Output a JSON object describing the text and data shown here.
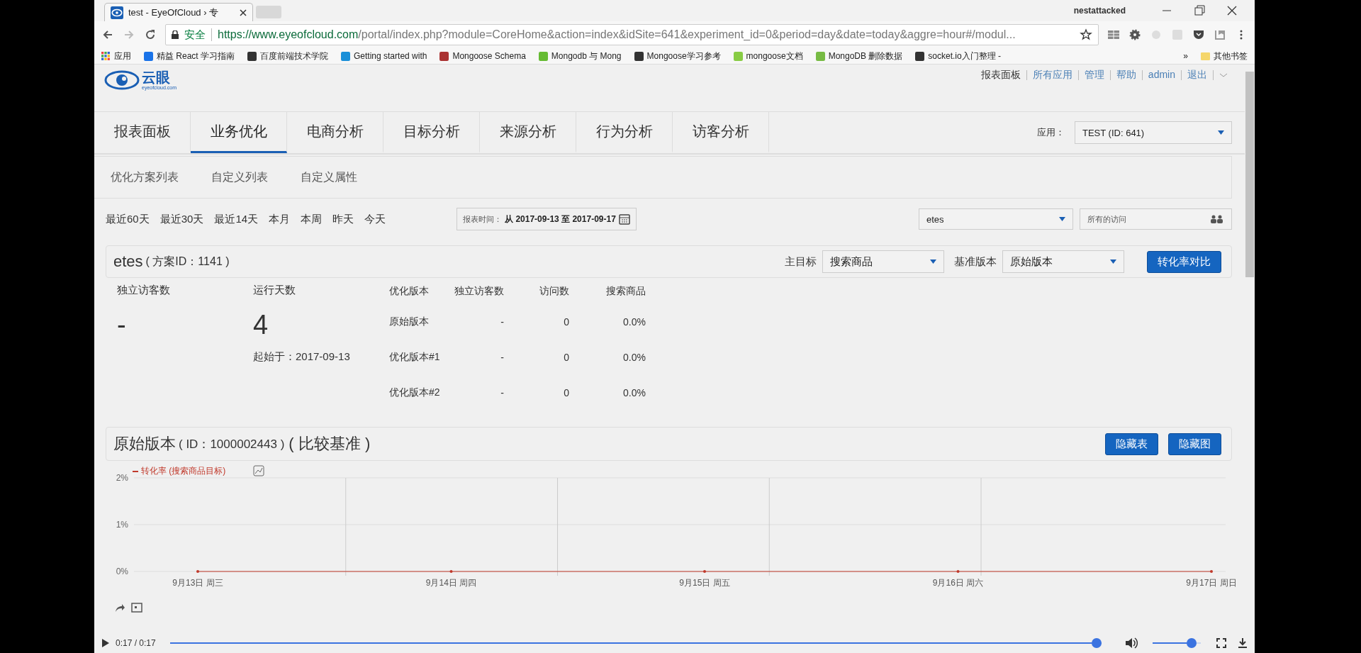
{
  "browser": {
    "tab_title": "test - EyeOfCloud › 专",
    "user": "nestattacked",
    "security": "安全",
    "url_host": "https://www.eyeofcloud.com",
    "url_path": "/portal/index.php?module=CoreHome&action=index&idSite=641&experiment_id=0&period=day&date=today&aggre=hour#/modul...",
    "bookmarks": [
      "应用",
      "精益 React 学习指南",
      "百度前端技术学院",
      "Getting started with",
      "Mongoose Schema",
      "Mongodb 与 Mong",
      "Mongoose学习参考",
      "mongoose文档",
      "MongoDB 删除数据",
      "socket.io入门整理 -"
    ],
    "more": "»",
    "other_bookmarks": "其他书签"
  },
  "top_links": [
    {
      "label": "报表面板",
      "active": true
    },
    {
      "label": "所有应用",
      "active": false
    },
    {
      "label": "管理",
      "active": false
    },
    {
      "label": "帮助",
      "active": false
    },
    {
      "label": "admin",
      "active": false
    },
    {
      "label": "退出",
      "active": false
    }
  ],
  "logo_text": "云眼",
  "logo_sub": "eyeofcloud.com",
  "nav_tabs": [
    {
      "label": "报表面板",
      "selected": false
    },
    {
      "label": "业务优化",
      "selected": true
    },
    {
      "label": "电商分析",
      "selected": false
    },
    {
      "label": "目标分析",
      "selected": false
    },
    {
      "label": "来源分析",
      "selected": false
    },
    {
      "label": "行为分析",
      "selected": false
    },
    {
      "label": "访客分析",
      "selected": false
    }
  ],
  "app_select": {
    "label": "应用：",
    "value": "TEST (ID: 641)"
  },
  "sub_nav": [
    "优化方案列表",
    "自定义列表",
    "自定义属性"
  ],
  "periods": [
    "最近60天",
    "最近30天",
    "最近14天",
    "本月",
    "本周",
    "昨天",
    "今天"
  ],
  "date_range": {
    "label": "报表时间：",
    "value": "从 2017-09-13 至 2017-09-17"
  },
  "experiment_select": "etes",
  "segment_select": "所有的访问",
  "experiment": {
    "name": "etes",
    "id_text": "( 方案ID：1141 )",
    "goal_label": "主目标",
    "goal": "搜索商品",
    "baseline_label": "基准版本",
    "baseline": "原始版本",
    "compare_button": "转化率对比"
  },
  "stats": [
    {
      "label": "独立访客数",
      "value": "-"
    },
    {
      "label": "运行天数",
      "value": "4",
      "note": "起始于：2017-09-13"
    }
  ],
  "table": {
    "columns": [
      "优化版本",
      "独立访客数",
      "访问数",
      "搜索商品"
    ],
    "rows": [
      [
        "原始版本",
        "-",
        "0",
        "0.0%"
      ],
      [
        "优化版本#1",
        "-",
        "0",
        "0.0%"
      ],
      [
        "优化版本#2",
        "-",
        "0",
        "0.0%"
      ]
    ]
  },
  "variation": {
    "name": "原始版本",
    "id_text": "( ID：1000002443 )",
    "note": "( 比较基准 )",
    "buttons": [
      "隐藏表",
      "隐藏图"
    ]
  },
  "chart_data": {
    "type": "line",
    "categories": [
      "9月13日 周三",
      "9月14日 周四",
      "9月15日 周五",
      "9月16日 周六",
      "9月17日 周日"
    ],
    "series": [
      {
        "name": "转化率 (搜索商品目标)",
        "color": "#c0392b",
        "values": [
          0,
          0,
          0,
          0,
          0
        ]
      }
    ],
    "ylim": [
      0,
      2
    ],
    "yticks": [
      {
        "value": 0,
        "label": "0%"
      },
      {
        "value": 1,
        "label": "1%"
      },
      {
        "value": 2,
        "label": "2%"
      }
    ]
  },
  "player": {
    "time": "0:17 / 0:17",
    "level": 1,
    "volume": {
      "level": 0.88
    }
  }
}
